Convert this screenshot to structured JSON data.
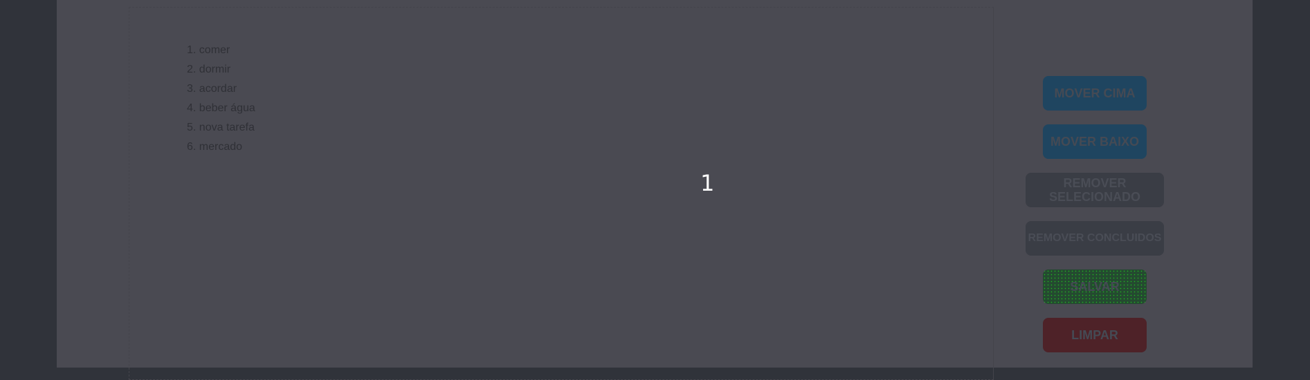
{
  "tasks": [
    "comer",
    "dormir",
    "acordar",
    "beber água",
    "nova tarefa",
    "mercado"
  ],
  "task_numbers": [
    "1.",
    "2.",
    "3.",
    "4.",
    "5.",
    "6."
  ],
  "counter": "1",
  "buttons": {
    "move_up": "MOVER CIMA",
    "move_down": "MOVER BAIXO",
    "remove_selected": "REMOVER SELECIONADO",
    "remove_done": "REMOVER CONCLUIDOS",
    "save": "SALVAR",
    "clear": "LIMPAR"
  },
  "colors": {
    "blue": "#1f4560",
    "gray": "#3a3d45",
    "green": "#244a30",
    "red": "#4e2228"
  }
}
